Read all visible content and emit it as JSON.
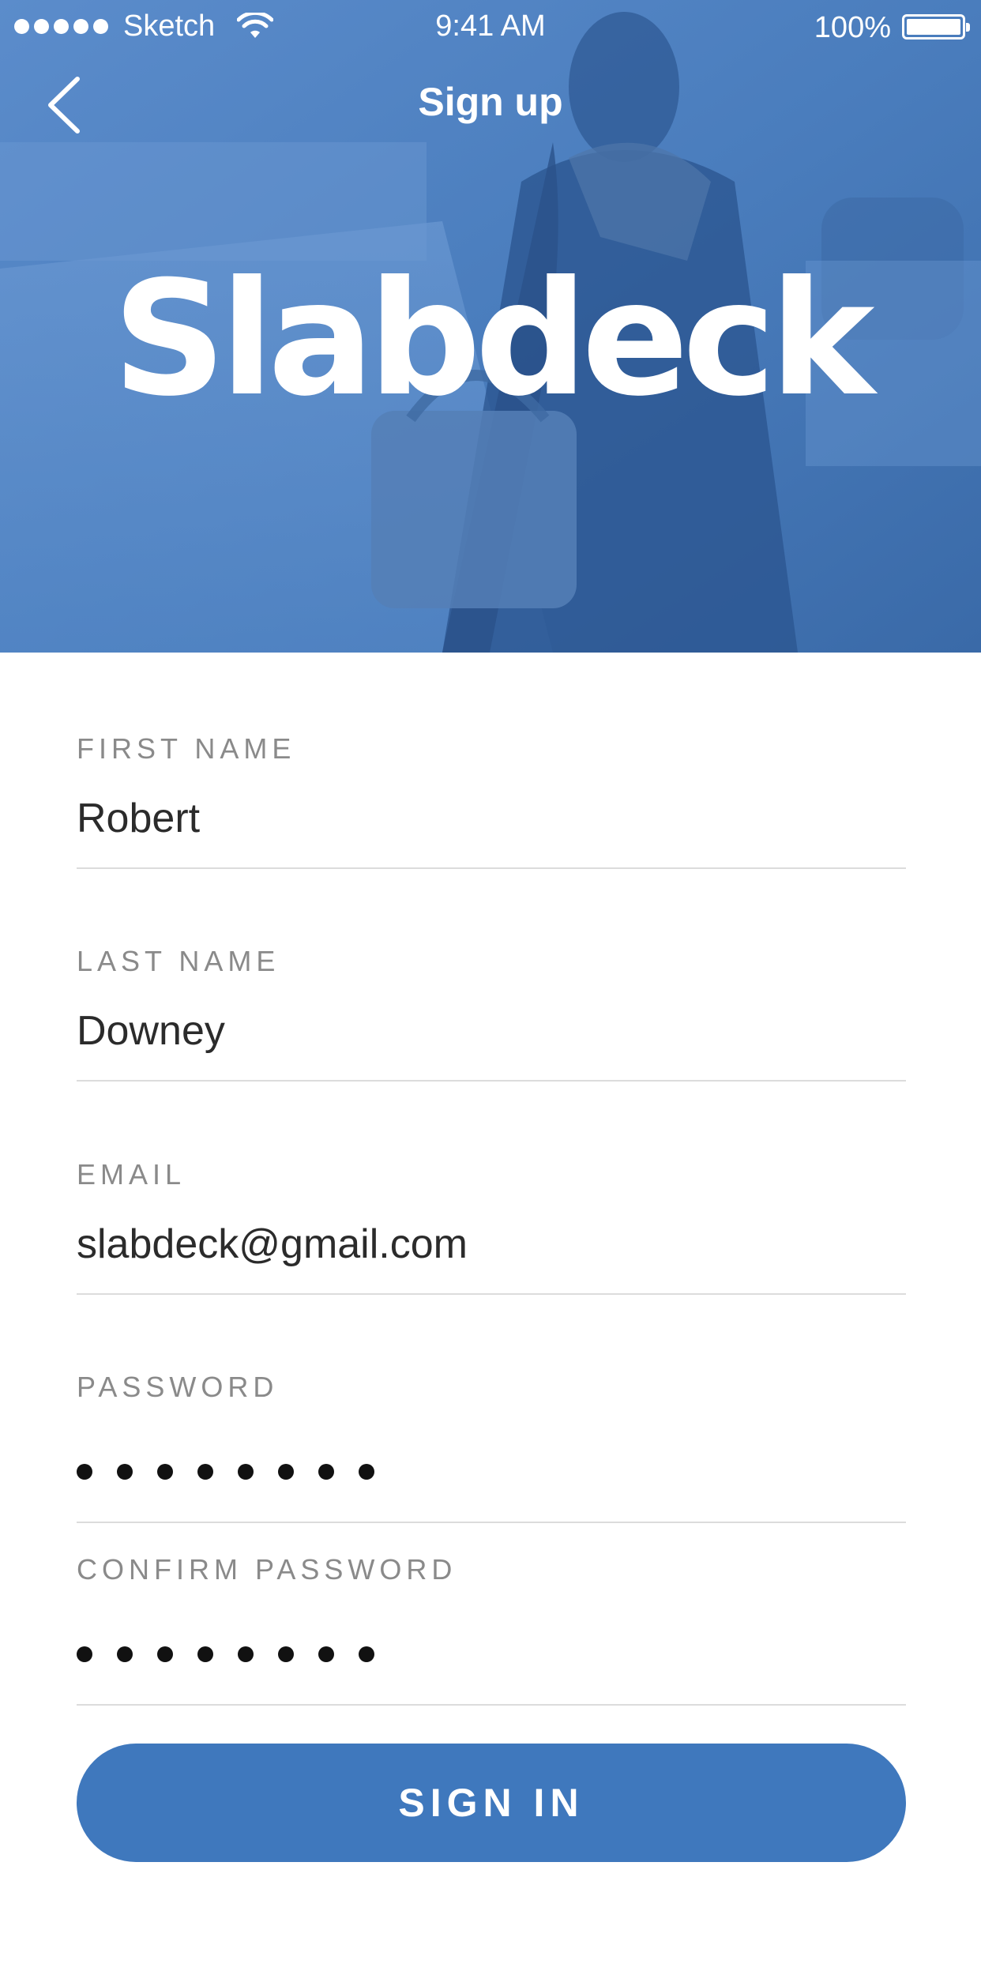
{
  "status_bar": {
    "carrier": "Sketch",
    "time": "9:41 AM",
    "battery": "100%"
  },
  "nav": {
    "title": "Sign up",
    "back_icon": "chevron-left-icon"
  },
  "logo": {
    "text": "Slabdeck"
  },
  "form": {
    "first_name": {
      "label": "FIRST NAME",
      "value": "Robert"
    },
    "last_name": {
      "label": "LAST NAME",
      "value": "Downey"
    },
    "email": {
      "label": "EMAIL",
      "value": "slabdeck@gmail.com"
    },
    "password": {
      "label": "PASSWORD",
      "masked_length": 8
    },
    "confirm_password": {
      "label": "CONFIRM PASSWORD",
      "masked_length": 8
    }
  },
  "button": {
    "label": "SIGN IN"
  },
  "colors": {
    "hero_overlay": "#3e73b4",
    "button": "#3f78bd",
    "label": "#8a8a8a",
    "value": "#2b2b2b",
    "divider": "#dcdcdc"
  }
}
